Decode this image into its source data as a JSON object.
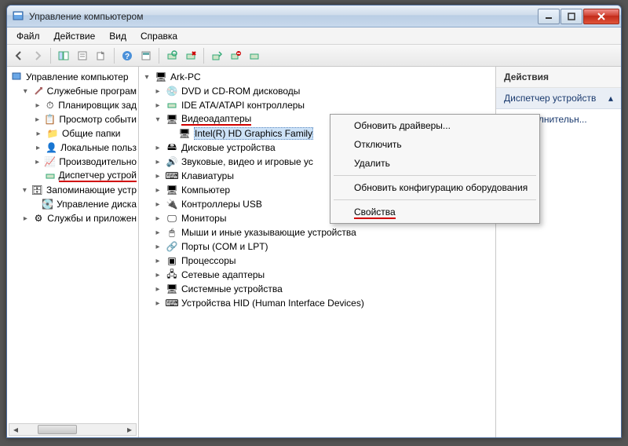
{
  "window": {
    "title": "Управление компьютером"
  },
  "menubar": [
    "Файл",
    "Действие",
    "Вид",
    "Справка"
  ],
  "left_tree": {
    "root": "Управление компьютер",
    "group1": "Служебные програм",
    "g1_items": [
      "Планировщик зад",
      "Просмотр событи",
      "Общие папки",
      "Локальные польз",
      "Производительно",
      "Диспетчер устрой"
    ],
    "group2": "Запоминающие устр",
    "g2_items": [
      "Управление диска"
    ],
    "group3": "Службы и приложен"
  },
  "device_tree": {
    "root": "Ark-PC",
    "items": [
      "DVD и CD-ROM дисководы",
      "IDE ATA/ATAPI контроллеры",
      "Видеоадаптеры",
      "Intel(R) HD Graphics Family",
      "Дисковые устройства",
      "Звуковые, видео и игровые ус",
      "Клавиатуры",
      "Компьютер",
      "Контроллеры USB",
      "Мониторы",
      "Мыши и иные указывающие устройства",
      "Порты (COM и LPT)",
      "Процессоры",
      "Сетевые адаптеры",
      "Системные устройства",
      "Устройства HID (Human Interface Devices)"
    ]
  },
  "context_menu": {
    "i0": "Обновить драйверы...",
    "i1": "Отключить",
    "i2": "Удалить",
    "i3": "Обновить конфигурацию оборудования",
    "i4": "Свойства"
  },
  "actions": {
    "title": "Действия",
    "section": "Диспетчер устройств",
    "extra": "Дополнительн..."
  }
}
